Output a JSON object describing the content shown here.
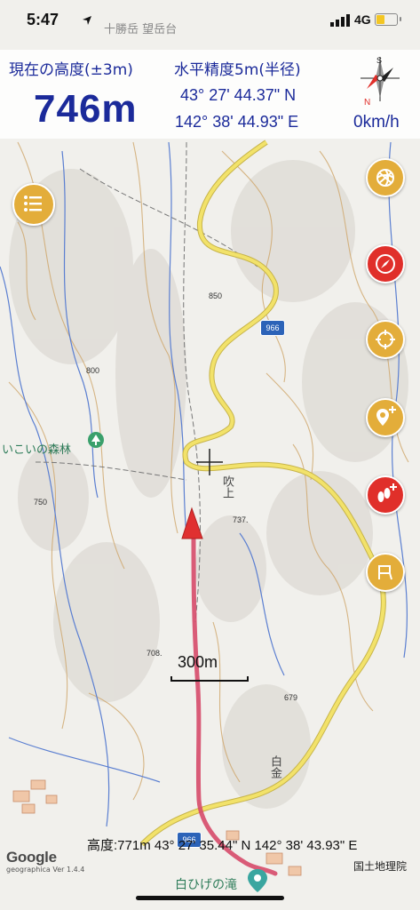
{
  "status_bar": {
    "time": "5:47",
    "network": "4G"
  },
  "header": {
    "altitude_label": "現在の高度(±3m)",
    "altitude_value": "746m",
    "accuracy_label": "水平精度5m(半径)",
    "latitude": "43° 27' 44.37\" N",
    "longitude": "142° 38' 44.93\" E",
    "speed": "0km/h"
  },
  "compass": {
    "north_label": "N",
    "south_label": "S"
  },
  "map": {
    "top_place_label": "十勝岳 望岳台",
    "forest_label": "いこいの森林",
    "falls_label": "白ひげの滝",
    "road_number_1": "966",
    "road_number_2": "966",
    "elev_850": "850",
    "elev_800": "800",
    "elev_737": "737.",
    "elev_708": "708.",
    "elev_679": "679",
    "elev_750": "750",
    "place_vertical_1": "吹上",
    "place_vertical_2": "白金",
    "scale_label": "300m",
    "crosshair_icon": "crosshair-icon"
  },
  "bottom": {
    "cursor_info": "高度:771m 43° 27' 35.44\" N 142° 38' 43.93\" E",
    "google_label": "Google",
    "app_version": "geographica Ver 1.4.4",
    "attribution": "国土地理院"
  },
  "buttons": {
    "menu": "list-icon",
    "layers": "spiral-icon",
    "compass_mode": "compass-needle-icon",
    "locate": "target-icon",
    "add_point": "pin-plus-icon",
    "add_track": "footsteps-plus-icon",
    "route": "route-flag-icon"
  },
  "colors": {
    "text_accent": "#1b2a9a",
    "fab_gold": "#e3ad3a",
    "fab_red": "#e02f2a",
    "track_red": "#d64a6a",
    "road_yellow": "#f2e26a",
    "road_outline": "#c7b44a"
  }
}
